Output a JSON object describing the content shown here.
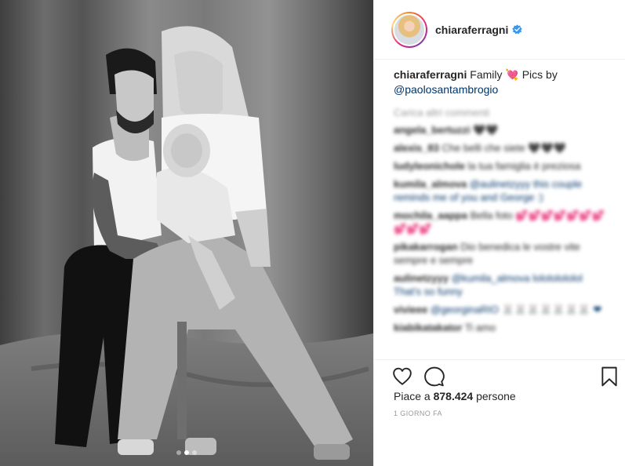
{
  "photo": {
    "alt": "Family",
    "carousel_total": 3,
    "carousel_active": 2
  },
  "header": {
    "username": "chiaraferragni",
    "verified_icon": "verified-badge-icon",
    "accent_color": "#3897f0"
  },
  "caption": {
    "username": "chiaraferragni",
    "text": "Family 💘 Pics by",
    "mention": "@paolosantambrogio"
  },
  "comments": {
    "load_more": "Carica altri commenti",
    "items": [
      {
        "user": "angela_bertuzzi",
        "text": "🖤🖤"
      },
      {
        "user": "alexis_83",
        "text": "Che belli che siete 🖤🖤🖤"
      },
      {
        "user": "ludyleonichole",
        "text": "la tua famiglia è preziosa"
      },
      {
        "user": "kumila_almova",
        "text": "@aulinetzyyy this couple reminds me of you and George :)"
      },
      {
        "user": "mochila_aappa",
        "text": "Bella foto 💕💕💕💕💕💕💕💕💕💕"
      },
      {
        "user": "pikakarrogan",
        "text": "Dio benedica le vostre vite sempre e sempre"
      },
      {
        "user": "aulinetzyyy",
        "text": "@kumila_almova lolololololol That's so funny"
      },
      {
        "user": "vivieee",
        "text": "@georginaRIO 🐰🐰🐰🐰🐰🐰🐰 ❤"
      },
      {
        "user": "kiabikatakator",
        "text": "Ti amo"
      }
    ]
  },
  "actions": {
    "like_icon": "heart-icon",
    "comment_icon": "speech-bubble-icon",
    "save_icon": "bookmark-icon"
  },
  "likes": {
    "prefix": "Piace a ",
    "count": "878.424",
    "suffix": " persone"
  },
  "timestamp": "1 GIORNO FA"
}
